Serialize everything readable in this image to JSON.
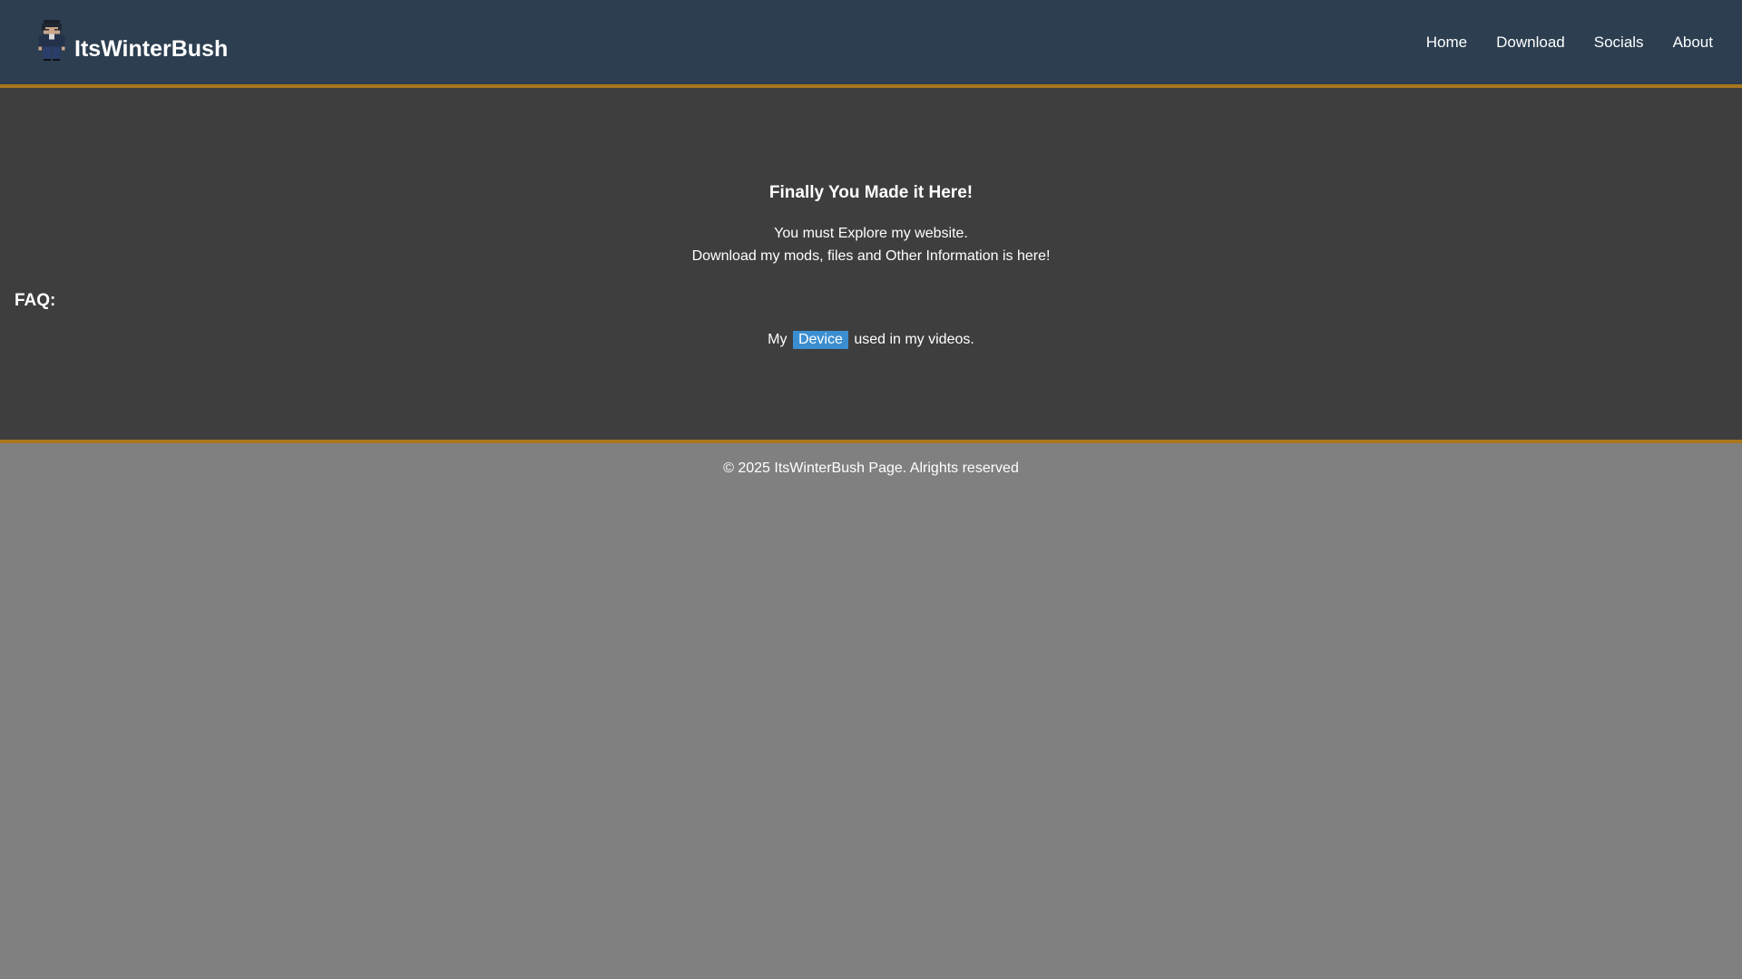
{
  "header": {
    "site_name": "ItsWinterBush",
    "logo_icon": "pixel-character-avatar-icon",
    "nav": [
      {
        "label": "Home"
      },
      {
        "label": "Download"
      },
      {
        "label": "Socials"
      },
      {
        "label": "About"
      }
    ]
  },
  "main": {
    "title": "Finally You Made it Here!",
    "line1": "You must Explore my website.",
    "line2": "Download my mods, files and Other Information is here!",
    "faq_heading": "FAQ:",
    "faq_prefix": "My",
    "faq_link": "Device",
    "faq_suffix": "used in my videos."
  },
  "footer": {
    "text": "© 2025 ItsWinterBush Page. Alrights reserved"
  },
  "colors": {
    "header_bg": "#2c3e50",
    "accent_border": "#a9761f",
    "main_bg": "#3e3e3e",
    "page_bg": "#808080",
    "link_highlight": "#3b8ed0"
  }
}
